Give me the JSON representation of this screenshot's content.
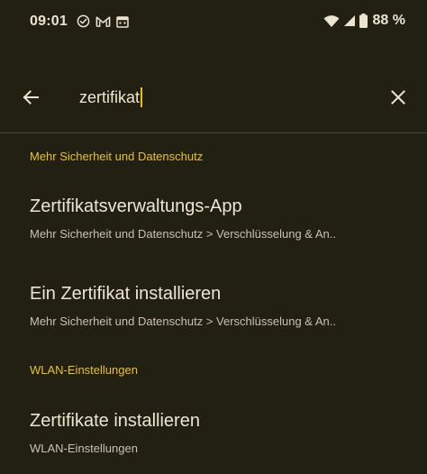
{
  "status_bar": {
    "time": "09:01",
    "battery": "88 %",
    "icons_left": [
      "check-circle-icon",
      "gmail-icon",
      "calendar-icon"
    ],
    "icons_right": [
      "wifi-icon",
      "signal-icon",
      "battery-icon"
    ]
  },
  "search": {
    "query": "zertifikat",
    "back_icon": "arrow-left-icon",
    "clear_icon": "close-icon"
  },
  "results": {
    "section_1": {
      "header": "Mehr Sicherheit und Datenschutz",
      "items": [
        {
          "title": "Zertifikatsverwaltungs-App",
          "subtitle": "Mehr Sicherheit und Datenschutz > Verschlüsselung & An.."
        },
        {
          "title": "Ein Zertifikat installieren",
          "subtitle": "Mehr Sicherheit und Datenschutz > Verschlüsselung & An.."
        }
      ]
    },
    "section_2": {
      "header": "WLAN-Einstellungen",
      "items": [
        {
          "title": "Zertifikate installieren",
          "subtitle": "WLAN-Einstellungen"
        }
      ]
    }
  },
  "colors": {
    "background": "#221f13",
    "accent": "#e8c22c",
    "text_primary": "#ede6d2",
    "text_secondary": "#c9c1ab"
  }
}
